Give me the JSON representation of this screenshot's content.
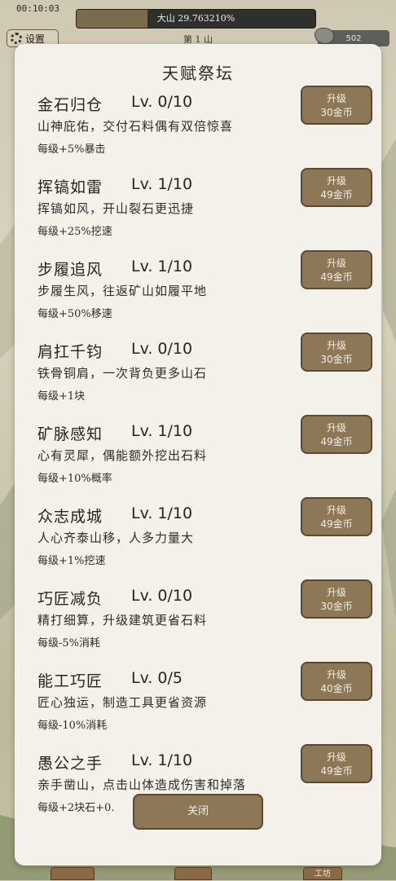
{
  "header": {
    "timer": "00:10:03",
    "progress_text": "大山 29.763210%",
    "progress_fraction": 0.2976,
    "settings_label": "设置",
    "mountain_label": "第 1 山",
    "stone_count": "502"
  },
  "modal": {
    "title": "天赋祭坛",
    "talents": [
      {
        "name": "金石归仓",
        "level": "Lv. 0/10",
        "desc": "山神庇佑，交付石料偶有双倍惊喜",
        "effect": "每级+5%暴击",
        "btn_top": "升级",
        "btn_bottom": "30金币"
      },
      {
        "name": "挥镐如雷",
        "level": "Lv. 1/10",
        "desc": "挥镐如风，开山裂石更迅捷",
        "effect": "每级+25%挖速",
        "btn_top": "升级",
        "btn_bottom": "49金币"
      },
      {
        "name": "步履追风",
        "level": "Lv. 1/10",
        "desc": "步履生风，往返矿山如履平地",
        "effect": "每级+50%移速",
        "btn_top": "升级",
        "btn_bottom": "49金币"
      },
      {
        "name": "肩扛千钧",
        "level": "Lv. 0/10",
        "desc": "铁骨铜肩，一次背负更多山石",
        "effect": "每级+1块",
        "btn_top": "升级",
        "btn_bottom": "30金币"
      },
      {
        "name": "矿脉感知",
        "level": "Lv. 1/10",
        "desc": "心有灵犀，偶能额外挖出石料",
        "effect": "每级+10%概率",
        "btn_top": "升级",
        "btn_bottom": "49金币"
      },
      {
        "name": "众志成城",
        "level": "Lv. 1/10",
        "desc": "人心齐泰山移，人多力量大",
        "effect": "每级+1%挖速",
        "btn_top": "升级",
        "btn_bottom": "49金币"
      },
      {
        "name": "巧匠减负",
        "level": "Lv. 0/10",
        "desc": "精打细算，升级建筑更省石料",
        "effect": "每级-5%消耗",
        "btn_top": "升级",
        "btn_bottom": "30金币"
      },
      {
        "name": "能工巧匠",
        "level": "Lv. 0/5",
        "desc": "匠心独运，制造工具更省资源",
        "effect": "每级-10%消耗",
        "btn_top": "升级",
        "btn_bottom": "40金币"
      },
      {
        "name": "愚公之手",
        "level": "Lv. 1/10",
        "desc": "亲手凿山，点击山体造成伤害和掉落",
        "effect": "每级+2块石+0.",
        "btn_top": "升级",
        "btn_bottom": "49金币"
      }
    ],
    "close_label": "关闭"
  },
  "footer": {
    "tab_right": "工坊"
  }
}
